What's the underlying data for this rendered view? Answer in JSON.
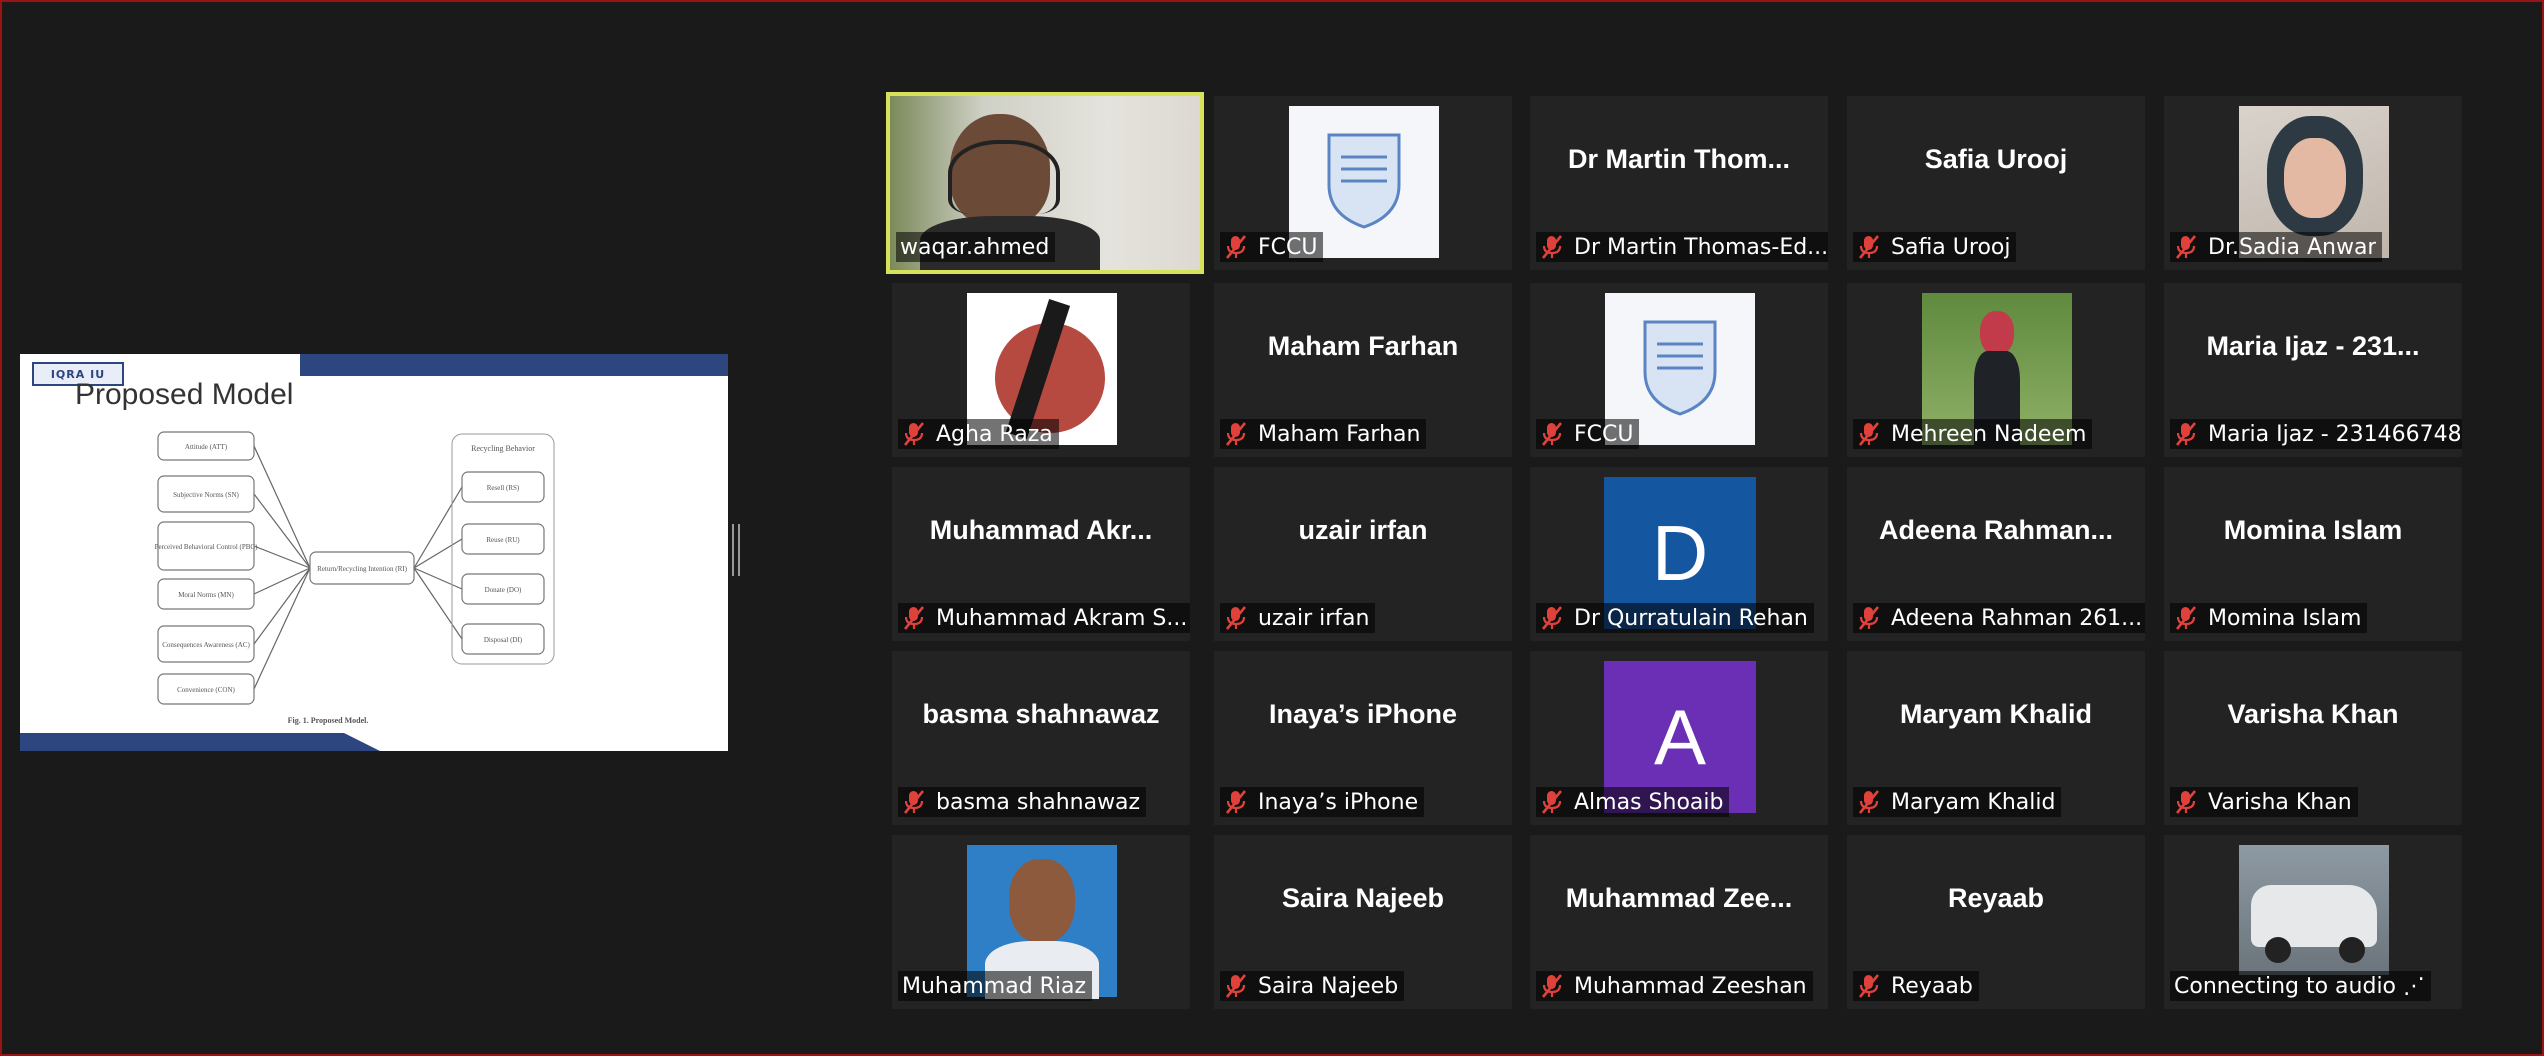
{
  "presentation": {
    "logo": "IQRA IU",
    "slide_title": "Proposed Model",
    "inputs": [
      "Attitude (ATT)",
      "Subjective Norms (SN)",
      "Perceived Behavioral Control (PBC)",
      "Moral Norms (MN)",
      "Consequences Awareness (AC)",
      "Convenience (CON)"
    ],
    "center": "Return/Recycling Intention (RI)",
    "outputs_title": "Recycling Behavior",
    "outputs": [
      "Resell (RS)",
      "Reuse (RU)",
      "Donate (DO)",
      "Disposal (DI)"
    ],
    "caption": "Fig. 1. Proposed Model."
  },
  "participants": [
    {
      "display": "",
      "label": "waqar.ahmed",
      "muted": false,
      "media": "video-waqar",
      "active": true
    },
    {
      "display": "",
      "label": "FCCU",
      "muted": true,
      "media": "fccu-logo"
    },
    {
      "display": "Dr Martin Thom...",
      "label": "Dr Martin Thomas-Ed...",
      "muted": true
    },
    {
      "display": "Safia Urooj",
      "label": "Safia Urooj",
      "muted": true
    },
    {
      "display": "",
      "label": "Dr.Sadia Anwar",
      "muted": true,
      "media": "photo-sadia"
    },
    {
      "display": "",
      "label": "Agha Raza",
      "muted": true,
      "media": "art-agha"
    },
    {
      "display": "Maham Farhan",
      "label": "Maham Farhan",
      "muted": true
    },
    {
      "display": "",
      "label": "FCCU",
      "muted": true,
      "media": "fccu-logo"
    },
    {
      "display": "",
      "label": "Mehreen Nadeem",
      "muted": true,
      "media": "photo-mehreen"
    },
    {
      "display": "Maria Ijaz - 231...",
      "label": "Maria Ijaz - 231466748",
      "muted": true
    },
    {
      "display": "Muhammad  Akr...",
      "label": "Muhammad Akram S...",
      "muted": true
    },
    {
      "display": "uzair irfan",
      "label": "uzair irfan",
      "muted": true
    },
    {
      "display": "",
      "label": "Dr Qurratulain Rehan",
      "muted": true,
      "media": "letter",
      "letter": "D",
      "color": "#1456a0"
    },
    {
      "display": "Adeena  Rahman...",
      "label": "Adeena Rahman 261...",
      "muted": true
    },
    {
      "display": "Momina Islam",
      "label": "Momina Islam",
      "muted": true
    },
    {
      "display": "basma shahnawaz",
      "label": "basma shahnawaz",
      "muted": true
    },
    {
      "display": "Inaya’s iPhone",
      "label": "Inaya’s iPhone",
      "muted": true
    },
    {
      "display": "",
      "label": "Almas Shoaib",
      "muted": true,
      "media": "letter",
      "letter": "A",
      "color": "#6a2fb5"
    },
    {
      "display": "Maryam Khalid",
      "label": "Maryam Khalid",
      "muted": true
    },
    {
      "display": "Varisha Khan",
      "label": "Varisha Khan",
      "muted": true
    },
    {
      "display": "",
      "label": "Muhammad Riaz",
      "muted": false,
      "media": "photo-riaz"
    },
    {
      "display": "Saira Najeeb",
      "label": "Saira Najeeb",
      "muted": true
    },
    {
      "display": "Muhammad  Zee...",
      "label": "Muhammad Zeeshan",
      "muted": true
    },
    {
      "display": "Reyaab",
      "label": "Reyaab",
      "muted": true
    },
    {
      "display": "",
      "label": "Connecting to audio ⋰",
      "muted": false,
      "media": "photo-car"
    }
  ],
  "colors": {
    "active_border": "#d6e25a",
    "muted_icon": "#e0413a",
    "tile_bg": "#232323"
  }
}
